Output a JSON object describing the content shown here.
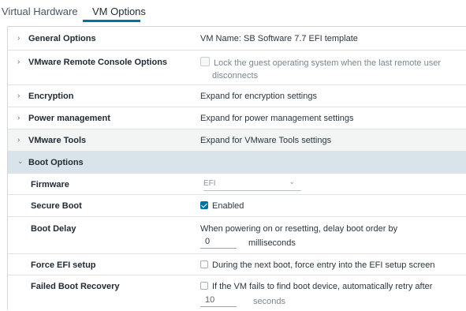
{
  "tabs": [
    {
      "label": "Virtual Hardware"
    },
    {
      "label": "VM Options"
    }
  ],
  "sections": {
    "general": {
      "label": "General Options",
      "value": "VM Name: SB Software 7.7 EFI template"
    },
    "remote_console": {
      "label": "VMware Remote Console Options",
      "checkbox_label_line1": "Lock the guest operating system when the last remote user",
      "checkbox_label_line2": "disconnects"
    },
    "encryption": {
      "label": "Encryption",
      "value": "Expand for encryption settings"
    },
    "power": {
      "label": "Power management",
      "value": "Expand for power management settings"
    },
    "tools": {
      "label": "VMware Tools",
      "value": "Expand for VMware Tools settings"
    },
    "boot": {
      "label": "Boot Options"
    }
  },
  "boot_options": {
    "firmware": {
      "label": "Firmware",
      "value": "EFI"
    },
    "secure_boot": {
      "label": "Secure Boot",
      "checkbox_label": "Enabled"
    },
    "boot_delay": {
      "label": "Boot Delay",
      "description": "When powering on or resetting, delay boot order by",
      "value": "0",
      "unit": "milliseconds"
    },
    "force_efi": {
      "label": "Force EFI setup",
      "checkbox_label": "During the next boot, force entry into the EFI setup screen"
    },
    "failed_recovery": {
      "label": "Failed Boot Recovery",
      "checkbox_label": "If the VM fails to find boot device, automatically retry after",
      "value": "10",
      "unit": "seconds"
    }
  },
  "icons": {
    "collapsed": "chevron-right-icon",
    "expanded": "chevron-down-icon",
    "dropdown": "chevron-down-icon"
  },
  "colors": {
    "accent": "#0072a3",
    "selected_row": "#d9e4ea",
    "shaded_row": "#f3f4f4"
  }
}
